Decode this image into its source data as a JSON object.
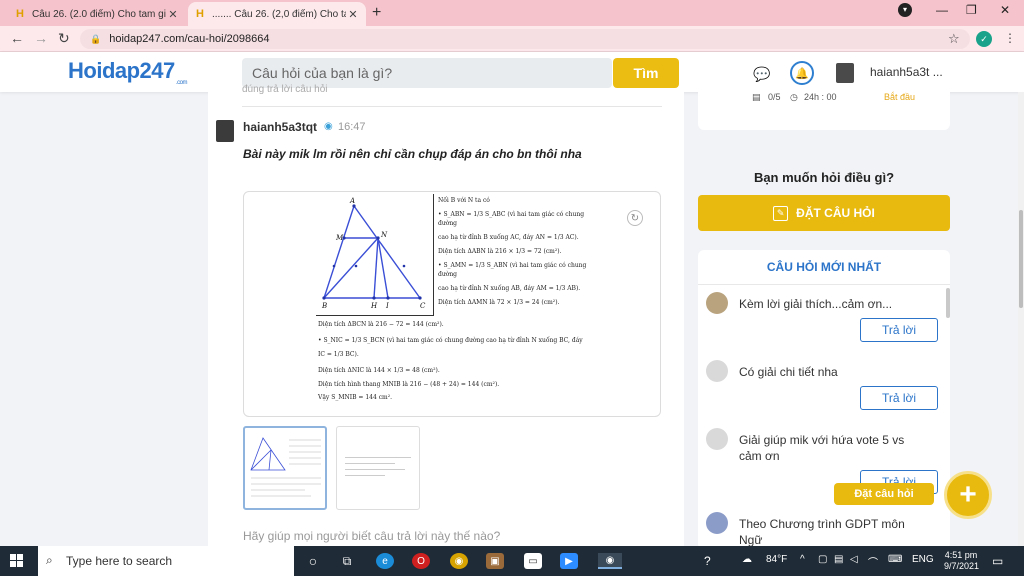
{
  "browser": {
    "tabs": [
      {
        "title": "Câu 26. (2.0 điểm) Cho tam giác"
      },
      {
        "title": "....... Câu 26. (2,0 điểm) Cho tam"
      }
    ],
    "url": "hoidap247.com/cau-hoi/2098664"
  },
  "header": {
    "logo": "Hoidap247",
    "logo_suffix": ".com",
    "search_placeholder": "Câu hỏi của bạn là gì?",
    "search_button": "Tìm",
    "username": "haianh5a3t ..."
  },
  "answer": {
    "previous_partial": "đúng trả lời câu hỏi",
    "username": "haianh5a3tqt",
    "time": "16:47",
    "text": "Bài này mik lm rồi nên chỉ cần chụp đáp án cho bn thôi nha",
    "help_prompt": "Hãy giúp mọi người biết câu trả lời này thế nào?"
  },
  "solution": {
    "lines_right": [
      "Nối B với N ta có",
      "• S_ABN = 1/3 S_ABC (vì hai tam giác có chung đường",
      "cao hạ từ đỉnh B xuống AC, đáy AN = 1/3 AC).",
      "Diện tích ΔABN là 216 × 1/3 = 72 (cm²).",
      "• S_AMN = 1/3 S_ABN (vì hai tam giác có chung đường",
      "cao hạ từ đỉnh N xuống AB, đáy AM = 1/3 AB).",
      "Diện tích ΔAMN là 72 × 1/3 = 24 (cm²)."
    ],
    "lines_bottom": [
      "Diện tích ΔBCN là 216 − 72 = 144 (cm²).",
      "• S_NIC = 1/3 S_BCN (vì hai tam giác có chung đường cao hạ từ đỉnh N xuống BC, đáy",
      "IC = 1/3 BC).",
      "Diện tích ΔNIC là 144 × 1/3 = 48 (cm²).",
      "Diện tích hình thang MNIB là 216 − (48 + 24) = 144 (cm²).",
      "Vậy S_MNIB = 144 cm²."
    ],
    "points": [
      "A",
      "M",
      "N",
      "B",
      "H",
      "I",
      "C"
    ]
  },
  "sidebar": {
    "stats": [
      "0/5",
      "24h : 00",
      "Bắt đầu"
    ],
    "ask_title": "Bạn muốn hỏi điều gì?",
    "ask_button": "ĐẶT CÂU HỎI",
    "new_title": "CÂU HỎI MỚI NHẤT",
    "questions": [
      {
        "text": "Kèm lời giải thích...cảm ơn...",
        "reply": "Trả lời"
      },
      {
        "text": "Có giải chi tiết nha",
        "reply": "Trả lời"
      },
      {
        "text": "Giải giúp mik với hứa vote 5 vs cảm ơn",
        "reply": "Trả lời"
      },
      {
        "text": "Theo Chương trình GDPT môn Ngữ",
        "reply": ""
      }
    ],
    "fab_label": "Đặt câu hỏi"
  },
  "taskbar": {
    "search": "Type here to search",
    "weather": "84°F",
    "lang": "ENG",
    "time": "4:51 pm",
    "date": "9/7/2021"
  },
  "colors": {
    "accent": "#e8b90f",
    "brand_blue": "#2b74c9",
    "tab_bar": "#f4c3cb"
  }
}
